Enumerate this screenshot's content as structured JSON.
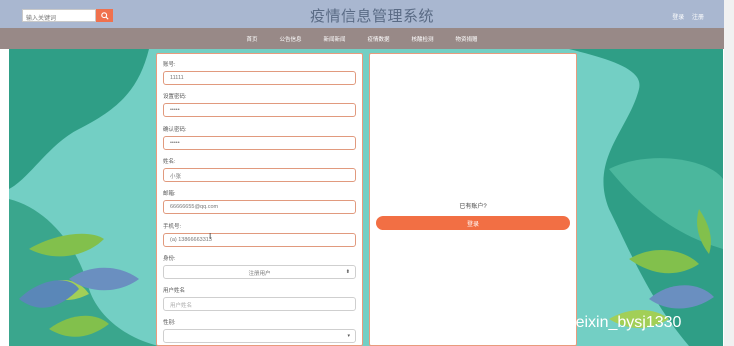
{
  "header": {
    "search_placeholder": "输入关键词",
    "title": "疫情信息管理系统",
    "link_login": "登录",
    "link_register": "注册"
  },
  "nav": {
    "items": [
      "首页",
      "公告信息",
      "新闻新闻",
      "疫情数据",
      "核酸检测",
      "物资捐赠"
    ]
  },
  "form": {
    "fields": [
      {
        "label": "账号:",
        "value": "11111"
      },
      {
        "label": "设置密码:",
        "value": "•••••"
      },
      {
        "label": "确认密码:",
        "value": "•••••"
      },
      {
        "label": "姓名:",
        "value": "小张"
      },
      {
        "label": "邮箱:",
        "value": "66666655@qq.com"
      },
      {
        "label": "手机号:",
        "value": "(a) 13866663313"
      }
    ],
    "identity_label": "身份:",
    "identity_value": "注册用户",
    "username_label": "用户姓名",
    "username_placeholder": "用户姓名",
    "gender_label": "性别:",
    "gender_value": ""
  },
  "side": {
    "have_account": "已有账户?",
    "login_button": "登录"
  },
  "watermark": "CSDN @weixin_bysj1330",
  "colors": {
    "accent": "#f26f44",
    "top_bar": "#a9b7d0",
    "nav_bar": "#988987",
    "background": "#73cfc4"
  }
}
